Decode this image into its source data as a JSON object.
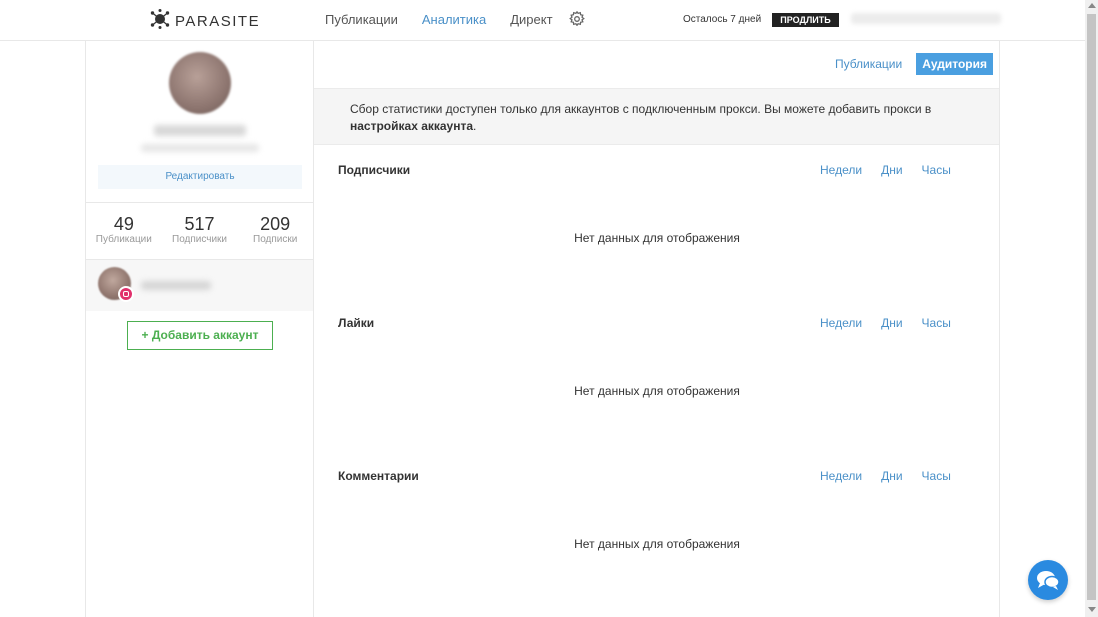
{
  "header": {
    "logo_text": "PARASITE",
    "nav": [
      "Публикации",
      "Аналитика",
      "Директ"
    ],
    "active_nav": "Аналитика",
    "days_left": "Осталось 7 дней",
    "renew_label": "ПРОДЛИТЬ"
  },
  "sidebar": {
    "edit_label": "Редактировать",
    "stats": [
      {
        "value": "49",
        "label": "Публикации"
      },
      {
        "value": "517",
        "label": "Подписчики"
      },
      {
        "value": "209",
        "label": "Подписки"
      }
    ],
    "add_account_label": "+ Добавить аккаунт"
  },
  "main": {
    "tabs": [
      "Публикации",
      "Аудитория"
    ],
    "active_tab": "Аудитория",
    "notice_text": "Сбор статистики доступен только для аккаунтов с подключенным прокси. Вы можете добавить прокси в ",
    "notice_link": "настройках аккаунта",
    "notice_end": ".",
    "sections": [
      {
        "title": "Подписчики",
        "links": [
          "Недели",
          "Дни",
          "Часы"
        ],
        "empty": "Нет данных для отображения"
      },
      {
        "title": "Лайки",
        "links": [
          "Недели",
          "Дни",
          "Часы"
        ],
        "empty": "Нет данных для отображения"
      },
      {
        "title": "Комментарии",
        "links": [
          "Недели",
          "Дни",
          "Часы"
        ],
        "empty": "Нет данных для отображения"
      }
    ]
  },
  "colors": {
    "accent": "#4a90c8",
    "tab_active": "#4a9fe0",
    "add_button": "#4caf50",
    "chat": "#2a8ae0",
    "instagram": "#e1306c"
  },
  "icons": {
    "logo": "parasite-logo-icon",
    "settings": "gear-icon",
    "chat": "chat-bubble-icon",
    "instagram": "instagram-icon"
  }
}
